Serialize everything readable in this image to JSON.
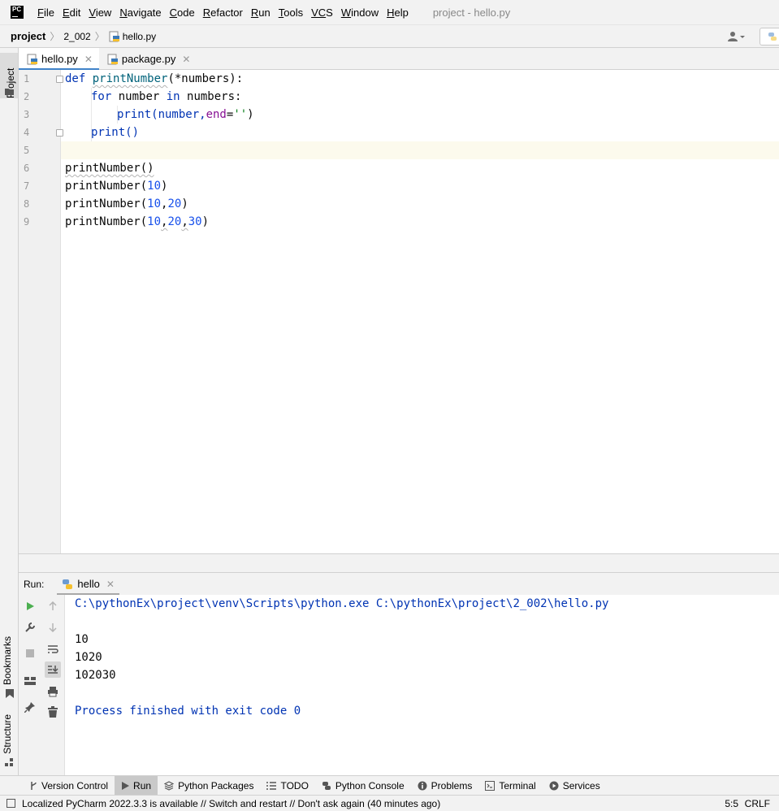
{
  "app": {
    "logo_text": "PC",
    "window_title": "project - hello.py"
  },
  "menu": [
    {
      "u": "F",
      "rest": "ile"
    },
    {
      "u": "E",
      "rest": "dit"
    },
    {
      "u": "V",
      "rest": "iew"
    },
    {
      "u": "N",
      "rest": "avigate"
    },
    {
      "u": "C",
      "rest": "ode"
    },
    {
      "u": "R",
      "rest": "efactor"
    },
    {
      "u": "R",
      "rest": "un"
    },
    {
      "u": "T",
      "rest": "ools"
    },
    {
      "u": "VC",
      "rest": "S"
    },
    {
      "u": "W",
      "rest": "indow"
    },
    {
      "u": "H",
      "rest": "elp"
    }
  ],
  "breadcrumb": {
    "project": "project",
    "folder": "2_002",
    "file": "hello.py"
  },
  "left_tools": {
    "project": "Project",
    "bookmarks": "Bookmarks",
    "structure": "Structure"
  },
  "tabs": [
    {
      "label": "hello.py",
      "active": true
    },
    {
      "label": "package.py",
      "active": false
    }
  ],
  "editor": {
    "line_numbers": [
      "1",
      "2",
      "3",
      "4",
      "5",
      "6",
      "7",
      "8",
      "9"
    ],
    "code": {
      "l1_kw": "def",
      "l1_fn": "printNumber",
      "l1_rest": "(*numbers):",
      "l2_kw1": "for",
      "l2_mid": " number ",
      "l2_kw2": "in",
      "l2_rest": " numbers:",
      "l3_call": "print(number,",
      "l3_param": "end",
      "l3_eq": "=",
      "l3_str": "''",
      "l3_close": ")",
      "l4": "print()",
      "l6": "printNumber()",
      "l7_a": "printNumber(",
      "l7_n1": "10",
      "l7_b": ")",
      "l8_a": "printNumber(",
      "l8_n1": "10",
      "l8_c1": ",",
      "l8_n2": "20",
      "l8_b": ")",
      "l9_a": "printNumber(",
      "l9_n1": "10",
      "l9_c1": ",",
      "l9_n2": "20",
      "l9_c2": ",",
      "l9_n3": "30",
      "l9_b": ")"
    }
  },
  "run": {
    "label": "Run:",
    "tab_label": "hello",
    "command": "C:\\pythonEx\\project\\venv\\Scripts\\python.exe C:\\pythonEx\\project\\2_002\\hello.py",
    "output": [
      "10",
      "1020",
      "102030"
    ],
    "exit_message": "Process finished with exit code 0"
  },
  "tool_windows": [
    {
      "label": "Version Control",
      "icon": "branch-icon",
      "active": false
    },
    {
      "label": "Run",
      "icon": "play-icon",
      "active": true
    },
    {
      "label": "Python Packages",
      "icon": "layers-icon",
      "active": false
    },
    {
      "label": "TODO",
      "icon": "list-icon",
      "active": false
    },
    {
      "label": "Python Console",
      "icon": "python-icon",
      "active": false
    },
    {
      "label": "Problems",
      "icon": "info-icon",
      "active": false
    },
    {
      "label": "Terminal",
      "icon": "terminal-icon",
      "active": false
    },
    {
      "label": "Services",
      "icon": "services-icon",
      "active": false
    }
  ],
  "status": {
    "message": "Localized PyCharm 2022.3.3 is available // Switch and restart // Don't ask again (40 minutes ago)",
    "position": "5:5",
    "line_ending": "CRLF"
  }
}
